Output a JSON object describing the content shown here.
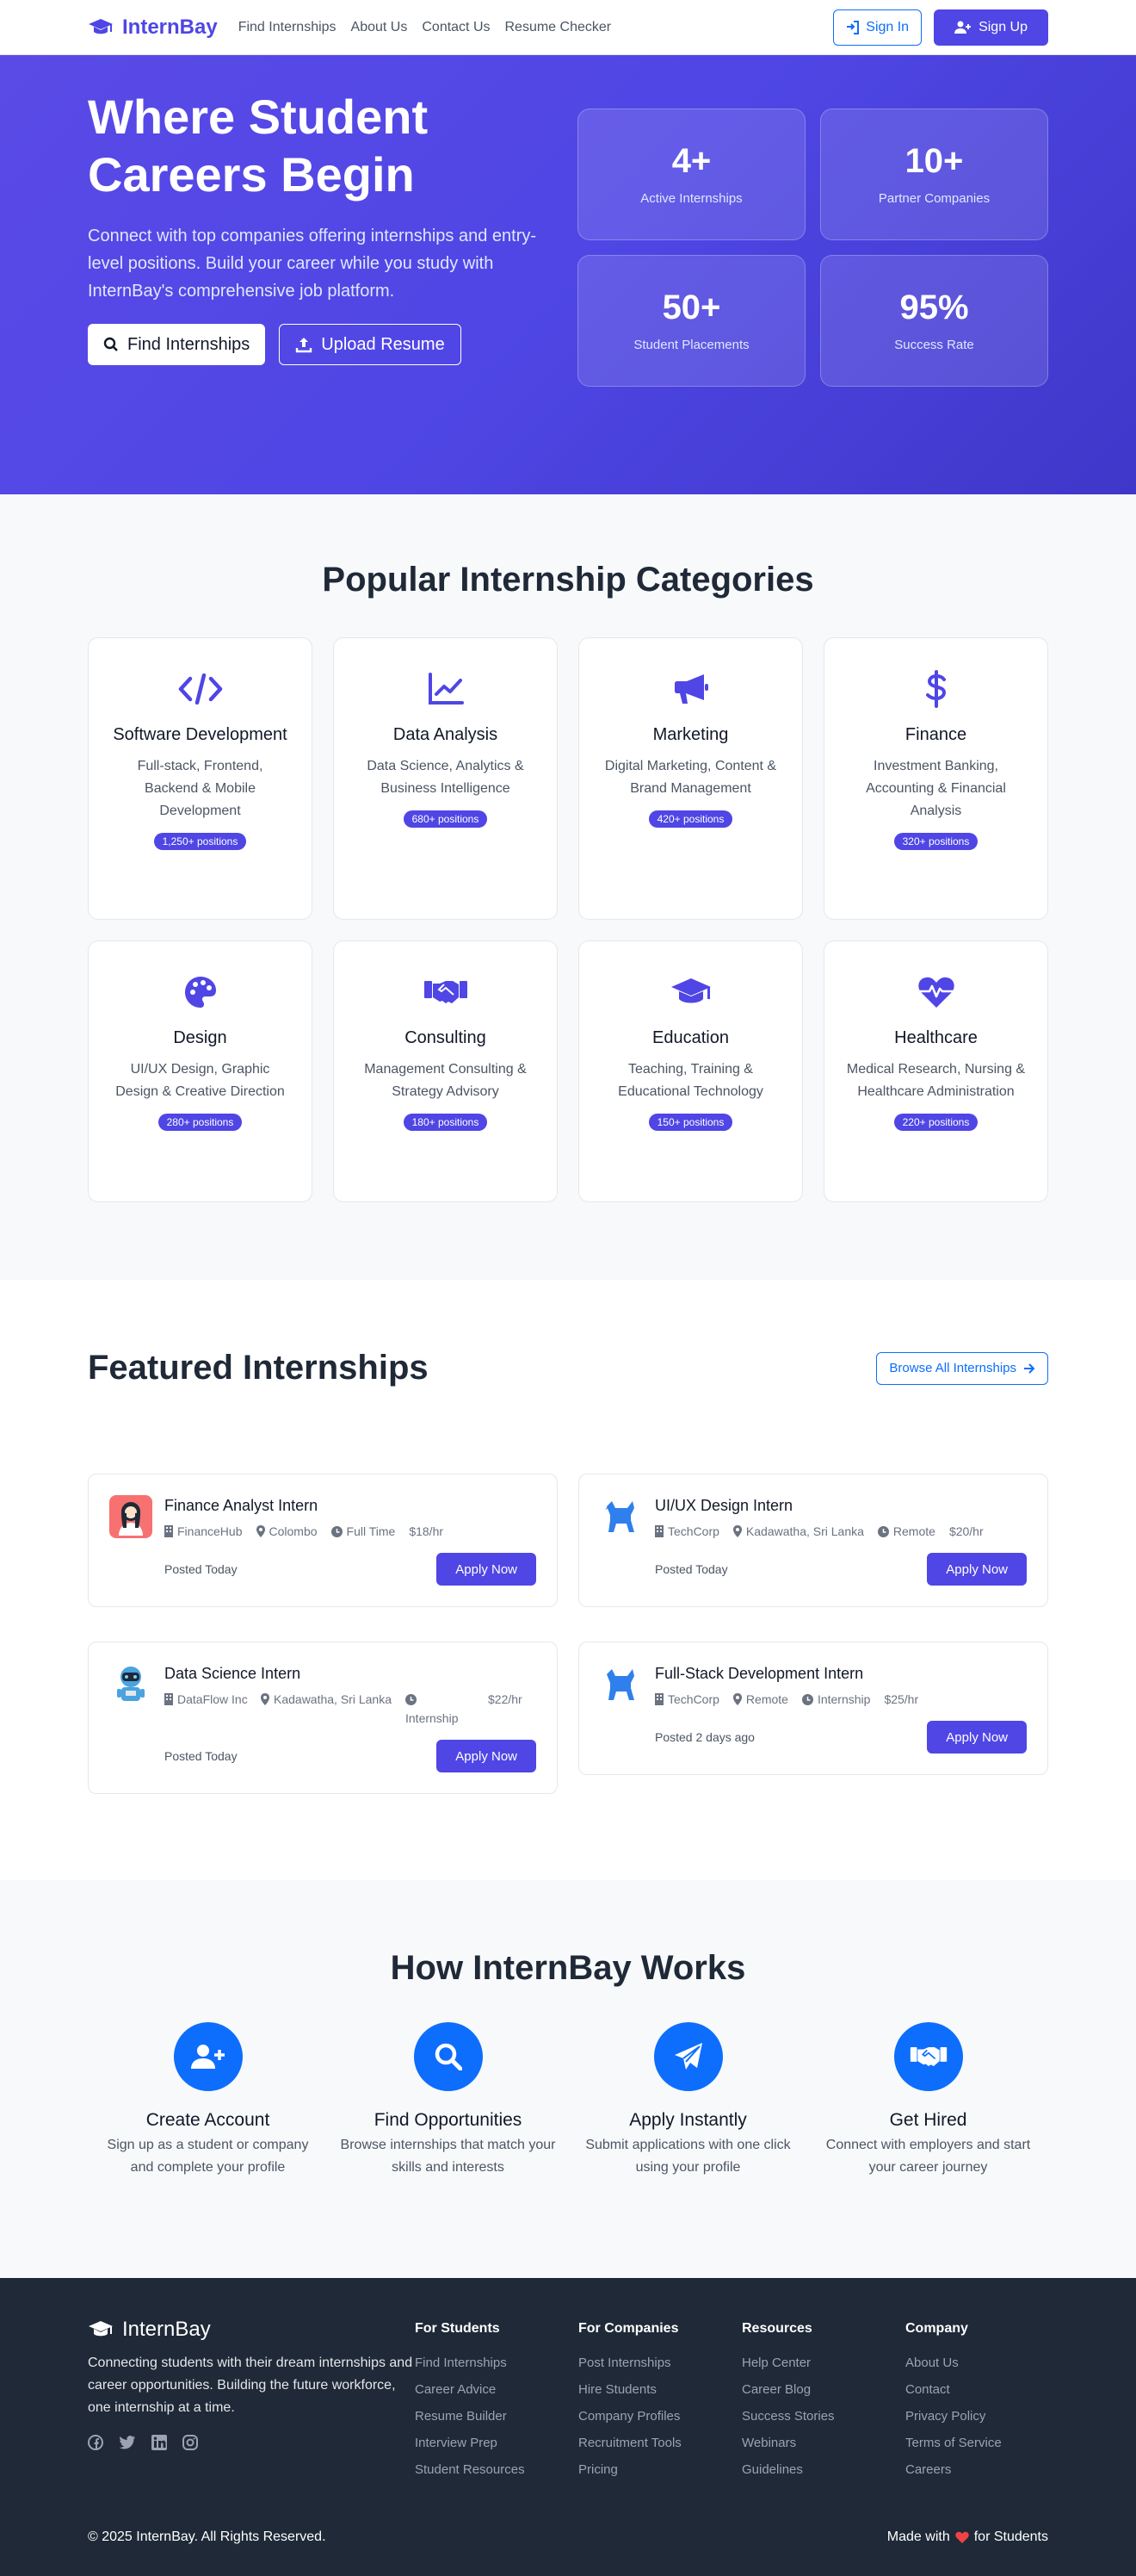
{
  "nav": {
    "brand": "InternBay",
    "links": [
      "Find Internships",
      "About Us",
      "Contact Us",
      "Resume Checker"
    ],
    "signin": "Sign In",
    "signup": "Sign Up"
  },
  "hero": {
    "title_line1": "Where Student",
    "title_line2": "Careers Begin",
    "subtitle": "Connect with top companies offering internships and entry-level positions. Build your career while you study with InternBay's comprehensive job platform.",
    "btn_find": "Find Internships",
    "btn_upload": "Upload Resume",
    "stats": [
      {
        "num": "4+",
        "label": "Active Internships"
      },
      {
        "num": "10+",
        "label": "Partner Companies"
      },
      {
        "num": "50+",
        "label": "Student Placements"
      },
      {
        "num": "95%",
        "label": "Success Rate"
      }
    ]
  },
  "categories": {
    "title": "Popular Internship Categories",
    "items": [
      {
        "icon": "code-icon",
        "name": "Software Development",
        "desc": "Full-stack, Frontend, Backend & Mobile Development",
        "count": "1,250+ positions"
      },
      {
        "icon": "chart-line-icon",
        "name": "Data Analysis",
        "desc": "Data Science, Analytics & Business Intelligence",
        "count": "680+ positions"
      },
      {
        "icon": "megaphone-icon",
        "name": "Marketing",
        "desc": "Digital Marketing, Content & Brand Management",
        "count": "420+ positions"
      },
      {
        "icon": "dollar-icon",
        "name": "Finance",
        "desc": "Investment Banking, Accounting & Financial Analysis",
        "count": "320+ positions"
      },
      {
        "icon": "palette-icon",
        "name": "Design",
        "desc": "UI/UX Design, Graphic Design & Creative Direction",
        "count": "280+ positions"
      },
      {
        "icon": "handshake-icon",
        "name": "Consulting",
        "desc": "Management Consulting & Strategy Advisory",
        "count": "180+ positions"
      },
      {
        "icon": "graduation-cap-icon",
        "name": "Education",
        "desc": "Teaching, Training & Educational Technology",
        "count": "150+ positions"
      },
      {
        "icon": "heartbeat-icon",
        "name": "Healthcare",
        "desc": "Medical Research, Nursing & Healthcare Administration",
        "count": "220+ positions"
      }
    ]
  },
  "featured": {
    "title": "Featured Internships",
    "browse": "Browse All Internships",
    "apply": "Apply Now",
    "jobs": [
      {
        "title": "Finance Analyst Intern",
        "company": "FinanceHub",
        "location": "Colombo",
        "type": "Full Time",
        "pay": "$18/hr",
        "posted": "Posted Today"
      },
      {
        "title": "UI/UX Design Intern",
        "company": "TechCorp",
        "location": "Kadawatha, Sri Lanka",
        "type": "Remote",
        "pay": "$20/hr",
        "posted": "Posted Today"
      },
      {
        "title": "Data Science Intern",
        "company": "DataFlow Inc",
        "location": "Kadawatha, Sri Lanka",
        "type": "Internship",
        "pay": "$22/hr",
        "posted": "Posted Today"
      },
      {
        "title": "Full-Stack Development Intern",
        "company": "TechCorp",
        "location": "Remote",
        "type": "Internship",
        "pay": "$25/hr",
        "posted": "Posted 2 days ago"
      }
    ]
  },
  "how": {
    "title": "How InternBay Works",
    "steps": [
      {
        "icon": "user-plus-icon",
        "title": "Create Account",
        "desc": "Sign up as a student or company and complete your profile"
      },
      {
        "icon": "search-icon",
        "title": "Find Opportunities",
        "desc": "Browse internships that match your skills and interests"
      },
      {
        "icon": "paper-plane-icon",
        "title": "Apply Instantly",
        "desc": "Submit applications with one click using your profile"
      },
      {
        "icon": "handshake-icon",
        "title": "Get Hired",
        "desc": "Connect with employers and start your career journey"
      }
    ]
  },
  "footer": {
    "brand": "InternBay",
    "tagline": "Connecting students with their dream internships and career opportunities. Building the future workforce, one internship at a time.",
    "columns": [
      {
        "title": "For Students",
        "links": [
          "Find Internships",
          "Career Advice",
          "Resume Builder",
          "Interview Prep",
          "Student Resources"
        ]
      },
      {
        "title": "For Companies",
        "links": [
          "Post Internships",
          "Hire Students",
          "Company Profiles",
          "Recruitment Tools",
          "Pricing"
        ]
      },
      {
        "title": "Resources",
        "links": [
          "Help Center",
          "Career Blog",
          "Success Stories",
          "Webinars",
          "Guidelines"
        ]
      },
      {
        "title": "Company",
        "links": [
          "About Us",
          "Contact",
          "Privacy Policy",
          "Terms of Service",
          "Careers"
        ]
      }
    ],
    "copyright": "© 2025 InternBay. All Rights Reserved.",
    "made_with": "Made with",
    "for_students": "for Students"
  },
  "colors": {
    "primary": "#4f46e5",
    "blue": "#0d6efd",
    "footer_bg": "#1f2937"
  }
}
